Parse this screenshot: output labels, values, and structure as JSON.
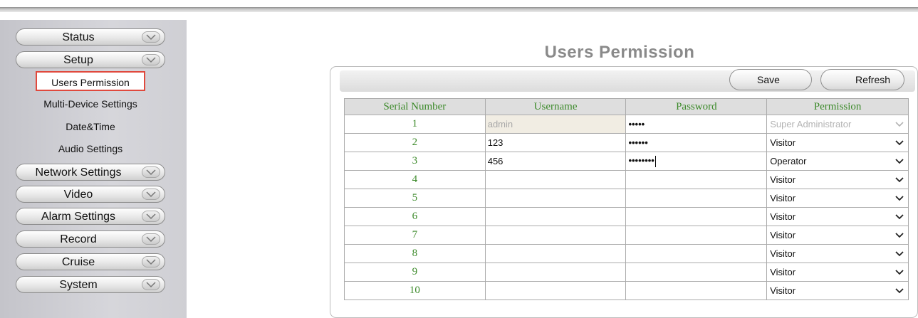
{
  "sidebar": {
    "menus_top": [
      {
        "label": "Status"
      },
      {
        "label": "Setup"
      }
    ],
    "submenu": [
      {
        "label": "Users Permission",
        "active": true
      },
      {
        "label": "Multi-Device Settings"
      },
      {
        "label": "Date&Time"
      },
      {
        "label": "Audio Settings"
      }
    ],
    "menus_bottom": [
      {
        "label": "Network Settings"
      },
      {
        "label": "Video"
      },
      {
        "label": "Alarm Settings"
      },
      {
        "label": "Record"
      },
      {
        "label": "Cruise"
      },
      {
        "label": "System"
      }
    ]
  },
  "main": {
    "title": "Users Permission",
    "save_label": "Save",
    "refresh_label": "Refresh",
    "columns": [
      "Serial Number",
      "Username",
      "Password",
      "Permission"
    ],
    "rows": [
      {
        "serial": "1",
        "username": "admin",
        "password": "•••••",
        "permission": "Super Administrator",
        "disabled": true
      },
      {
        "serial": "2",
        "username": "123",
        "password": "••••••",
        "permission": "Visitor"
      },
      {
        "serial": "3",
        "username": "456",
        "password": "••••••••",
        "permission": "Operator",
        "focused": true
      },
      {
        "serial": "4",
        "username": "",
        "password": "",
        "permission": "Visitor"
      },
      {
        "serial": "5",
        "username": "",
        "password": "",
        "permission": "Visitor"
      },
      {
        "serial": "6",
        "username": "",
        "password": "",
        "permission": "Visitor"
      },
      {
        "serial": "7",
        "username": "",
        "password": "",
        "permission": "Visitor"
      },
      {
        "serial": "8",
        "username": "",
        "password": "",
        "permission": "Visitor"
      },
      {
        "serial": "9",
        "username": "",
        "password": "",
        "permission": "Visitor"
      },
      {
        "serial": "10",
        "username": "",
        "password": "",
        "permission": "Visitor"
      }
    ]
  },
  "colors": {
    "accent_green": "#3c8a2a",
    "active_border": "#e0493d"
  }
}
